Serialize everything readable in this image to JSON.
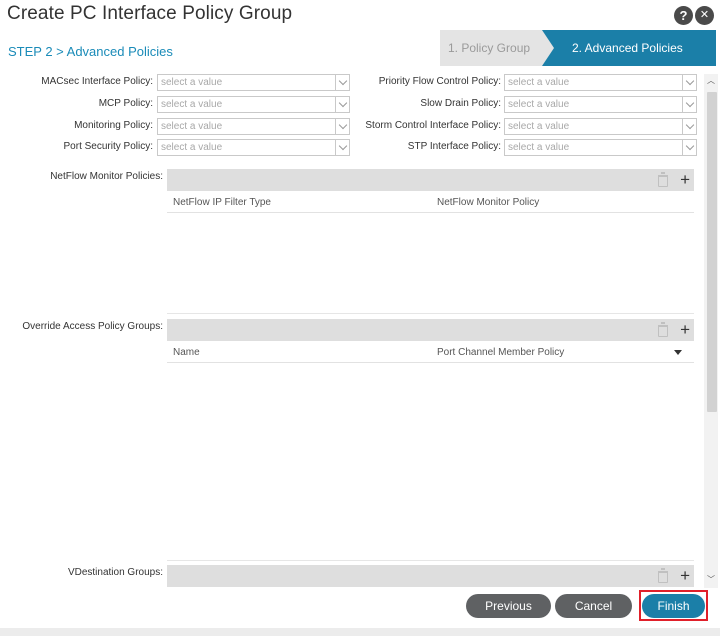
{
  "header": {
    "title": "Create PC Interface Policy Group",
    "help_glyph": "?",
    "close_glyph": "✕"
  },
  "step_label": "STEP 2 > Advanced Policies",
  "wizard": {
    "steps": [
      {
        "label": "1. Policy Group",
        "active": false
      },
      {
        "label": "2. Advanced Policies",
        "active": true
      }
    ]
  },
  "policies": {
    "left": [
      {
        "label": "MACsec Interface Policy:",
        "placeholder": "select a value"
      },
      {
        "label": "MCP Policy:",
        "placeholder": "select a value"
      },
      {
        "label": "Monitoring Policy:",
        "placeholder": "select a value"
      },
      {
        "label": "Port Security Policy:",
        "placeholder": "select a value"
      }
    ],
    "right": [
      {
        "label": "Priority Flow Control Policy:",
        "placeholder": "select a value"
      },
      {
        "label": "Slow Drain Policy:",
        "placeholder": "select a value"
      },
      {
        "label": "Storm Control Interface Policy:",
        "placeholder": "select a value"
      },
      {
        "label": "STP Interface Policy:",
        "placeholder": "select a value"
      }
    ]
  },
  "netflow": {
    "label": "NetFlow Monitor Policies:",
    "columns": [
      "NetFlow IP Filter Type",
      "NetFlow Monitor Policy"
    ]
  },
  "override": {
    "label": "Override Access Policy Groups:",
    "columns": [
      "Name",
      "Port Channel Member Policy"
    ]
  },
  "vdest": {
    "label": "VDestination Groups:"
  },
  "footer": {
    "previous": "Previous",
    "cancel": "Cancel",
    "finish": "Finish"
  },
  "colors": {
    "accent": "#1b7fa8",
    "step_text": "#1a8bb8",
    "grey_button": "#5f6163",
    "highlight": "#e0202a"
  }
}
